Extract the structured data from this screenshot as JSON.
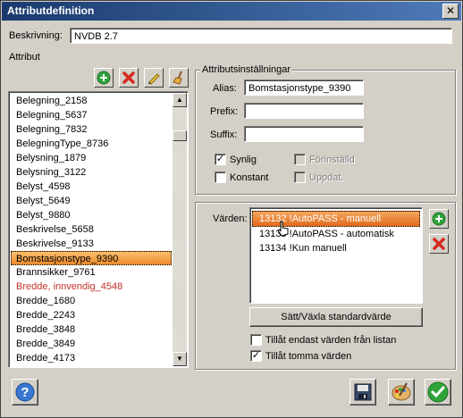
{
  "window": {
    "title": "Attributdefinition",
    "close_glyph": "✕"
  },
  "beskrivning": {
    "label": "Beskrivning:",
    "value": "NVDB 2.7"
  },
  "attribut": {
    "label": "Attribut",
    "toolbar_icons": [
      "add-icon",
      "delete-icon",
      "edit-pencil-icon",
      "clear-broom-icon"
    ],
    "items": [
      {
        "text": "Belegning_2158",
        "red": false
      },
      {
        "text": "Belegning_5637",
        "red": false
      },
      {
        "text": "Belegning_7832",
        "red": false
      },
      {
        "text": "BelegningType_8736",
        "red": false
      },
      {
        "text": "Belysning_1879",
        "red": false
      },
      {
        "text": "Belysning_3122",
        "red": false
      },
      {
        "text": "Belyst_4598",
        "red": false
      },
      {
        "text": "Belyst_5649",
        "red": false
      },
      {
        "text": "Belyst_9880",
        "red": false
      },
      {
        "text": "Beskrivelse_5658",
        "red": false
      },
      {
        "text": "Beskrivelse_9133",
        "red": false
      },
      {
        "text": "Bomstasjonstype_9390",
        "red": false,
        "selected": true
      },
      {
        "text": "Brannsikker_9761",
        "red": false
      },
      {
        "text": "Bredde, innvendig_4548",
        "red": true
      },
      {
        "text": "Bredde_1680",
        "red": false
      },
      {
        "text": "Bredde_2243",
        "red": false
      },
      {
        "text": "Bredde_3848",
        "red": false
      },
      {
        "text": "Bredde_3849",
        "red": false
      },
      {
        "text": "Bredde_4173",
        "red": false
      }
    ]
  },
  "settings": {
    "title": "Attributsinställningar",
    "alias_label": "Alias:",
    "alias_value": "Bomstasjonstype_9390",
    "prefix_label": "Prefix:",
    "prefix_value": "",
    "suffix_label": "Suffix:",
    "suffix_value": "",
    "synlig_label": "Synlig",
    "synlig_checked": true,
    "forinstalld_label": "Förinställd",
    "forinstalld_checked": false,
    "konstant_label": "Konstant",
    "konstant_checked": false,
    "uppdat_label": "Uppdat.",
    "uppdat_checked": false
  },
  "values": {
    "label": "Värden:",
    "items": [
      {
        "text": "13132 !AutoPASS - manuell",
        "selected": true
      },
      {
        "text": "13133 !AutoPASS - automatisk",
        "selected": false
      },
      {
        "text": "13134 !Kun manuell",
        "selected": false
      }
    ],
    "set_default_button": "Sätt/Växla standardvärde",
    "only_list_label": "Tillåt endast värden från listan",
    "only_list_checked": false,
    "allow_empty_label": "Tillåt tomma värden",
    "allow_empty_checked": true
  },
  "footer": {
    "help_icon": "help-icon",
    "save_icon": "save-disk-icon",
    "palette_icon": "palette-icon",
    "ok_icon": "ok-check-icon"
  },
  "colors": {
    "title_start": "#1a3a6e",
    "title_end": "#4e7bb8",
    "selection": "#ec8a2a",
    "red_item": "#c0302a",
    "green_icon": "#2fa43a",
    "red_icon": "#d42a1e"
  }
}
